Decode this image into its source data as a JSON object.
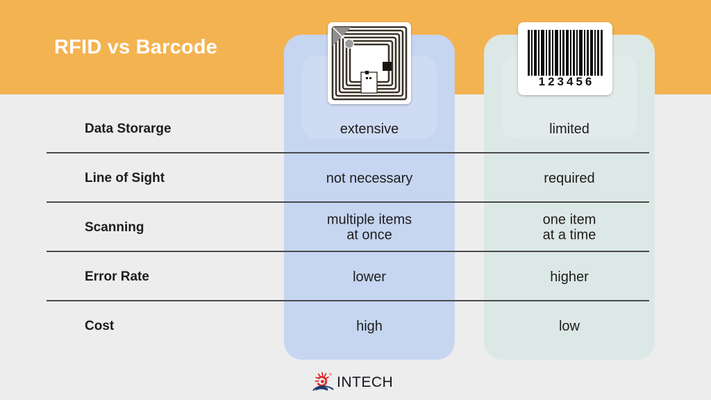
{
  "header": {
    "title": "RFID vs Barcode",
    "band_color": "#f4b351",
    "title_color": "#ffffff"
  },
  "columns": [
    {
      "key": "rfid",
      "name": "RFID",
      "panel_color": "#c6d5f0",
      "media_icon": "rfid-tag-icon"
    },
    {
      "key": "barcode",
      "name": "Barcode",
      "panel_color": "#dce8e6",
      "media_icon": "barcode-label-icon",
      "barcode_digits": "123456"
    }
  ],
  "rows": [
    {
      "label": "Data Storarge",
      "rfid": "extensive",
      "barcode": "limited"
    },
    {
      "label": "Line of Sight",
      "rfid": "not necessary",
      "barcode": "required"
    },
    {
      "label": "Scanning",
      "rfid": "multiple items\nat once",
      "barcode": "one item\nat a time"
    },
    {
      "label": "Error Rate",
      "rfid": "lower",
      "barcode": "higher"
    },
    {
      "label": "Cost",
      "rfid": "high",
      "barcode": "low"
    }
  ],
  "logo": {
    "wordmark": "INTECH",
    "mark_icon": "intech-sunburst-logo-icon",
    "mark_color": "#e02020",
    "arc_color": "#1b3a6b",
    "word_color": "#14161c"
  },
  "background_color": "#ededed",
  "divider_color": "#4a4a4a"
}
